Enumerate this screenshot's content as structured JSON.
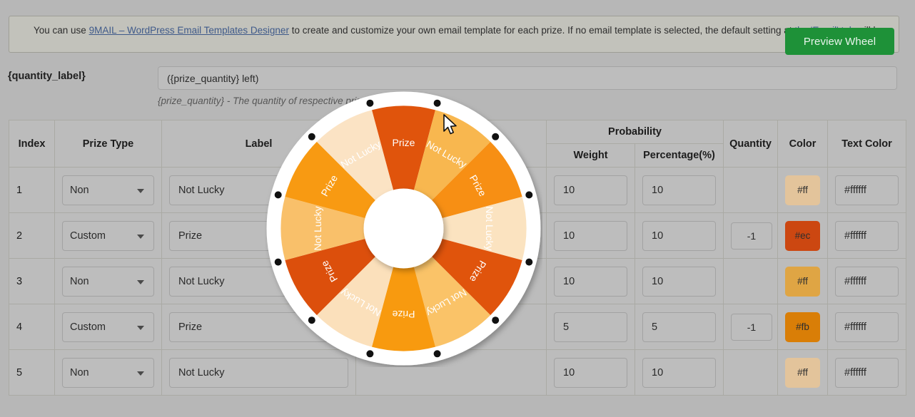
{
  "notice": {
    "bullet_prefix": "You can use ",
    "link_text": "9MAIL – WordPress Email Templates Designer",
    "middle_text": " to create and customize your own email template for each prize. If no email template is selected, the default setting at ",
    "link2_text": "the 'Email' tab",
    "suffix_text": " will be used."
  },
  "toolbar": {
    "preview_wheel_label": "Preview Wheel"
  },
  "quantity_row": {
    "label": "{quantity_label}",
    "value": "({prize_quantity} left)",
    "placeholder": "({prize_quantity} left)",
    "hint": "{prize_quantity} - The quantity of respective prize"
  },
  "table": {
    "headers": {
      "index": "Index",
      "prize_type": "Prize Type",
      "label": "Label",
      "description": "",
      "probability": "Probability",
      "weight": "Weight",
      "percentage": "Percentage(%)",
      "quantity": "Quantity",
      "color": "Color",
      "text_color": "Text Color"
    },
    "type_options": [
      "Non",
      "Custom"
    ],
    "rows": [
      {
        "index": "1",
        "prize_type": "Non",
        "label": "Not Lucky",
        "weight": "10",
        "percentage": "10",
        "quantity": "",
        "color_text": "#ff",
        "color_swatch": "#e3c49b",
        "text_color": "#ffffff"
      },
      {
        "index": "2",
        "prize_type": "Custom",
        "label": "Prize",
        "weight": "10",
        "percentage": "10",
        "quantity": "-1",
        "color_text": "#ec",
        "color_swatch": "#cc4711",
        "text_color": "#ffffff"
      },
      {
        "index": "3",
        "prize_type": "Non",
        "label": "Not Lucky",
        "weight": "10",
        "percentage": "10",
        "quantity": "",
        "color_text": "#ff",
        "color_swatch": "#dfa544",
        "text_color": "#ffffff"
      },
      {
        "index": "4",
        "prize_type": "Custom",
        "label": "Prize",
        "weight": "5",
        "percentage": "5",
        "quantity": "-1",
        "color_text": "#fb",
        "color_swatch": "#d97e07",
        "text_color": "#ffffff"
      },
      {
        "index": "5",
        "prize_type": "Non",
        "label": "Not Lucky",
        "weight": "10",
        "percentage": "10",
        "quantity": "",
        "color_text": "#ff",
        "color_swatch": "#e3c49b",
        "text_color": "#ffffff"
      }
    ]
  },
  "wheel": {
    "segment_count": 12,
    "hub_color": "#ffffff",
    "rim_color": "#ffffff",
    "dot_color": "#111111",
    "dot_count": 12,
    "segments": [
      {
        "label": "Prize",
        "color": "#e0540c"
      },
      {
        "label": "Not Lucky",
        "color": "#f8b74f"
      },
      {
        "label": "Prize",
        "color": "#f78f14"
      },
      {
        "label": "Not Lucky",
        "color": "#fbe3c0"
      },
      {
        "label": "Prize",
        "color": "#e0540c"
      },
      {
        "label": "Not Lucky",
        "color": "#fac368"
      },
      {
        "label": "Prize",
        "color": "#f89a0f"
      },
      {
        "label": "Not Lucky",
        "color": "#fbe0bb"
      },
      {
        "label": "Prize",
        "color": "#dc4f0c"
      },
      {
        "label": "Not Lucky",
        "color": "#f9c06a"
      },
      {
        "label": "Prize",
        "color": "#f89a12"
      },
      {
        "label": "Not Lucky",
        "color": "#fbe3c4"
      }
    ]
  }
}
